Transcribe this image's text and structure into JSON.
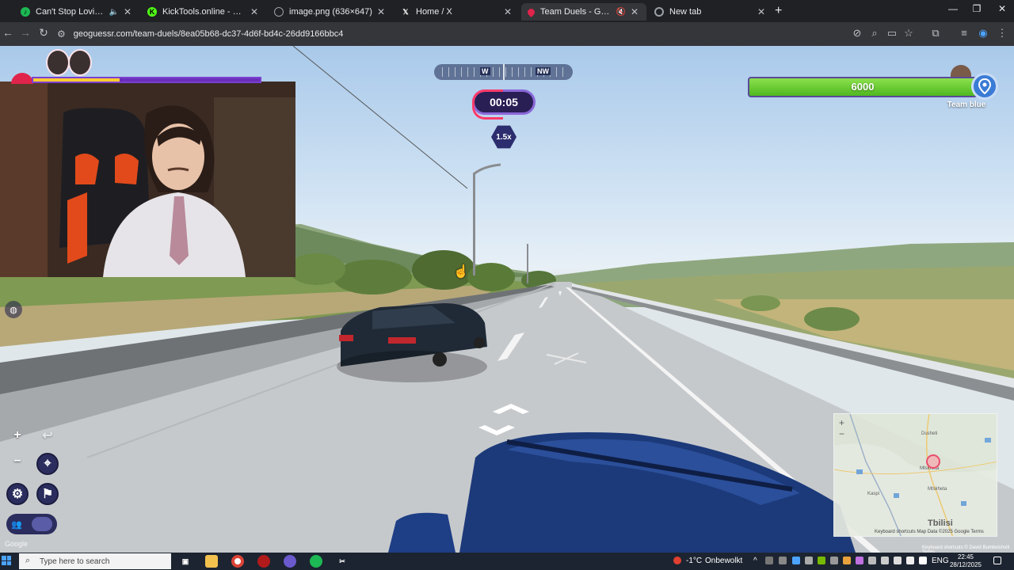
{
  "browser": {
    "tabs": [
      {
        "title": "Can't Stop Loving You • Ki",
        "icon": "spotify-icon",
        "color": "#1db954",
        "active": false,
        "muted": true
      },
      {
        "title": "KickTools.online - Ultimate Kick",
        "icon": "kick-icon",
        "color": "#53fc18",
        "active": false,
        "muted": false
      },
      {
        "title": "image.png (636×647)",
        "icon": "globe-icon",
        "color": "#9aa0a6",
        "active": false,
        "muted": false
      },
      {
        "title": "Home / X",
        "icon": "x-icon",
        "color": "#ffffff",
        "active": false,
        "muted": false
      },
      {
        "title": "Team Duels - GeoGuessr",
        "icon": "geoguessr-icon",
        "color": "#e0244b",
        "active": true,
        "muted": true
      },
      {
        "title": "New tab",
        "icon": "chrome-icon",
        "color": "#9aa0a6",
        "active": false,
        "muted": false
      }
    ],
    "url": "geoguessr.com/team-duels/8ea05b68-dc37-4d6f-bd4c-26dd9166bbc4"
  },
  "game": {
    "compass": {
      "west": "W",
      "northwest": "NW"
    },
    "timer": "00:05",
    "multiplier": "1.5x",
    "team_health": "6000",
    "team_health_fraction": 1.0,
    "opponent_health_fraction": 0.38,
    "team_name": "Team blue"
  },
  "minimap": {
    "zoom_in": "+",
    "zoom_out": "−",
    "labels": [
      "Dusheti",
      "Kaspi",
      "Mtskheta",
      "Mtskheta"
    ],
    "city": "Tbilisi",
    "footer": "Keyboard shortcuts  Map Data ©2025 Google  Terms"
  },
  "streetview_footer": "Keyboard shortcuts  © David Bumbeishvili  Terms",
  "google_logo": "Google",
  "taskbar": {
    "search_placeholder": "Type here to search",
    "weather_temp": "-1°C",
    "weather_text": "Onbewolkt",
    "language": "ENG",
    "time": "22:45",
    "date": "28/12/2025"
  },
  "colors": {
    "accent_purple": "#2b2d5e",
    "health_green": "#6fd13a",
    "team_blue": "#3a7bd5"
  }
}
